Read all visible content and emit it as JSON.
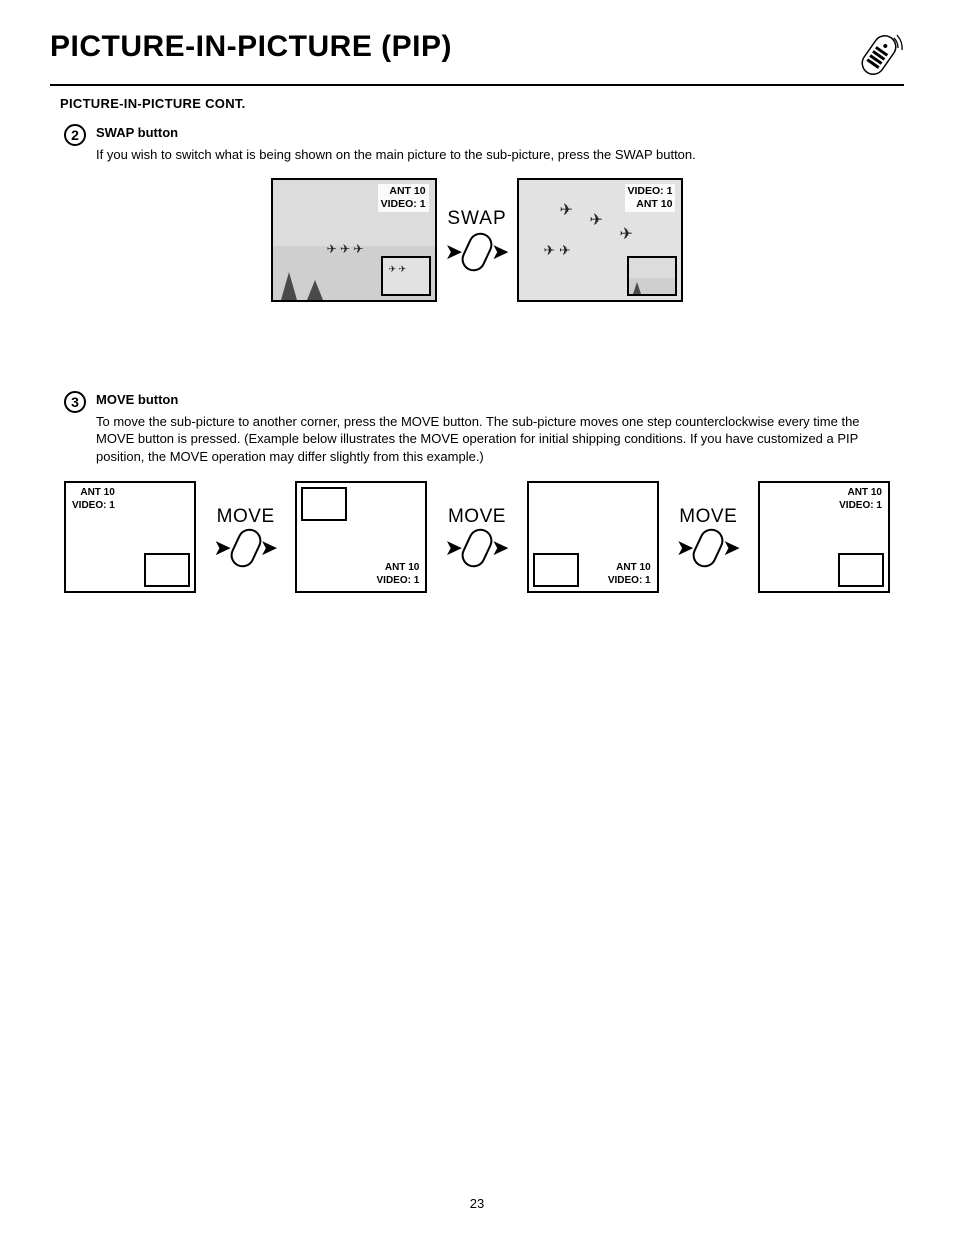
{
  "page": {
    "title": "PICTURE-IN-PICTURE (PIP)",
    "subhead": "PICTURE-IN-PICTURE CONT."
  },
  "sec2": {
    "num": "2",
    "label": "SWAP button",
    "body": "If you wish to switch what is being shown on the main picture to the sub-picture, press the SWAP button."
  },
  "swap": {
    "label": "SWAP",
    "left_osd_line1": "ANT    10",
    "left_osd_line2": "VIDEO: 1",
    "right_osd_line1": "VIDEO: 1",
    "right_osd_line2": "ANT    10"
  },
  "sec3": {
    "num": "3",
    "label": "MOVE button",
    "body": "To move the sub-picture to another corner, press the MOVE button.  The sub-picture moves one step counterclockwise every time the MOVE button is pressed.  (Example below illustrates the MOVE operation for initial shipping conditions.  If you have customized a PIP position, the MOVE operation may differ slightly from this example.)"
  },
  "move": {
    "label": "MOVE",
    "osd_line1": "ANT    10",
    "osd_line2": "VIDEO: 1"
  },
  "pagenum": "23"
}
